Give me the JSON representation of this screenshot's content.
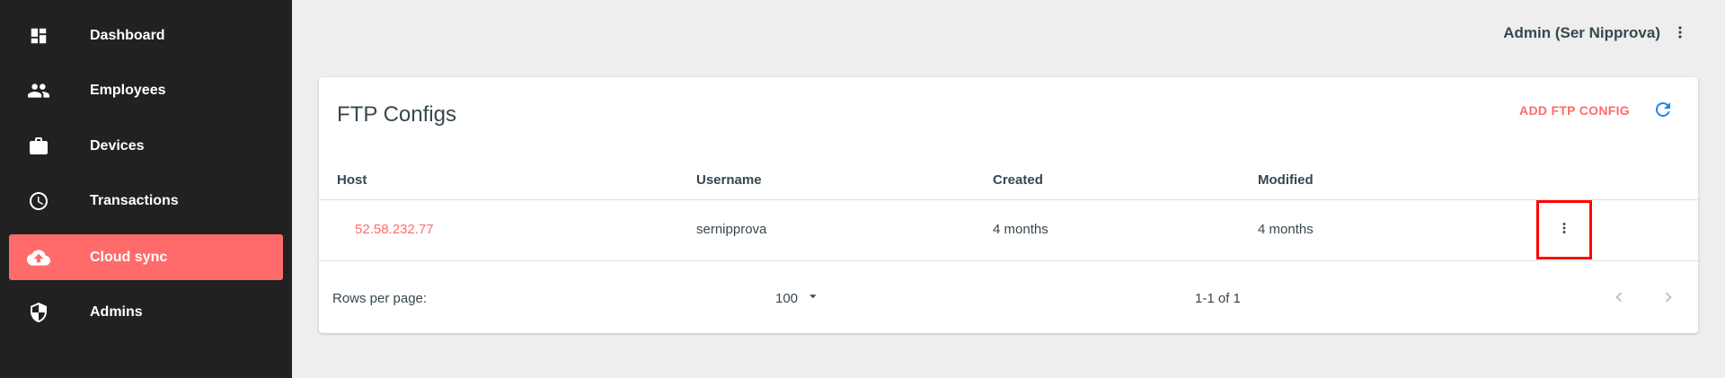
{
  "sidebar": {
    "items": [
      {
        "label": "Dashboard",
        "icon": "dashboard-icon"
      },
      {
        "label": "Employees",
        "icon": "people-icon"
      },
      {
        "label": "Devices",
        "icon": "briefcase-icon"
      },
      {
        "label": "Transactions",
        "icon": "clock-icon"
      },
      {
        "label": "Cloud sync",
        "icon": "cloud-upload-icon",
        "active": true
      },
      {
        "label": "Admins",
        "icon": "shield-icon"
      }
    ]
  },
  "header": {
    "user": "Admin (Ser Nipprova)",
    "menu_icon": "more-vert-icon"
  },
  "card": {
    "title": "FTP Configs",
    "add_label": "ADD FTP CONFIG",
    "refresh_icon": "refresh-icon"
  },
  "table": {
    "columns": [
      "Host",
      "Username",
      "Created",
      "Modified"
    ],
    "rows": [
      {
        "host": "52.58.232.77",
        "username": "sernipprova",
        "created": "4 months",
        "modified": "4 months"
      }
    ]
  },
  "pagination": {
    "rows_per_page_label": "Rows per page:",
    "rows_per_page": "100",
    "range": "1-1 of 1"
  },
  "colors": {
    "accent": "#ff6b6b",
    "sidebar_bg": "#212121",
    "refresh": "#1e88e5",
    "highlight": "#ff0000"
  }
}
